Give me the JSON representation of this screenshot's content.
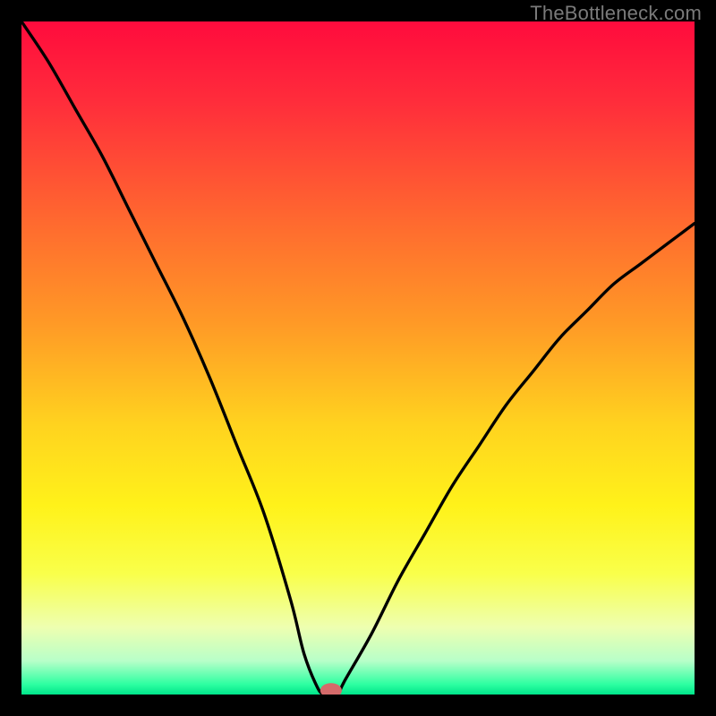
{
  "watermark": "TheBottleneck.com",
  "chart_data": {
    "type": "line",
    "title": "",
    "xlabel": "",
    "ylabel": "",
    "xlim": [
      0,
      100
    ],
    "ylim": [
      0,
      100
    ],
    "background_gradient": {
      "from_top_stops": [
        {
          "offset": 0.0,
          "color": "#ff0b3d"
        },
        {
          "offset": 0.12,
          "color": "#ff2d3b"
        },
        {
          "offset": 0.3,
          "color": "#ff6a2f"
        },
        {
          "offset": 0.45,
          "color": "#ff9a26"
        },
        {
          "offset": 0.6,
          "color": "#ffd31f"
        },
        {
          "offset": 0.72,
          "color": "#fff21a"
        },
        {
          "offset": 0.82,
          "color": "#f9ff4a"
        },
        {
          "offset": 0.9,
          "color": "#eeffb0"
        },
        {
          "offset": 0.95,
          "color": "#b8ffc9"
        },
        {
          "offset": 0.985,
          "color": "#2dffa1"
        },
        {
          "offset": 1.0,
          "color": "#00e58a"
        }
      ]
    },
    "series": [
      {
        "name": "bottleneck-curve",
        "x": [
          0,
          4,
          8,
          12,
          16,
          20,
          24,
          28,
          32,
          36,
          40,
          42,
          44,
          45,
          46,
          47,
          48,
          52,
          56,
          60,
          64,
          68,
          72,
          76,
          80,
          84,
          88,
          92,
          96,
          100
        ],
        "y": [
          100,
          94,
          87,
          80,
          72,
          64,
          56,
          47,
          37,
          27,
          14,
          6,
          1,
          0,
          0,
          0,
          2,
          9,
          17,
          24,
          31,
          37,
          43,
          48,
          53,
          57,
          61,
          64,
          67,
          70
        ]
      }
    ],
    "marker": {
      "name": "optimal-point",
      "x": 46,
      "y": 0.6,
      "rx": 1.6,
      "ry": 1.1,
      "color": "#d46a6a"
    }
  }
}
